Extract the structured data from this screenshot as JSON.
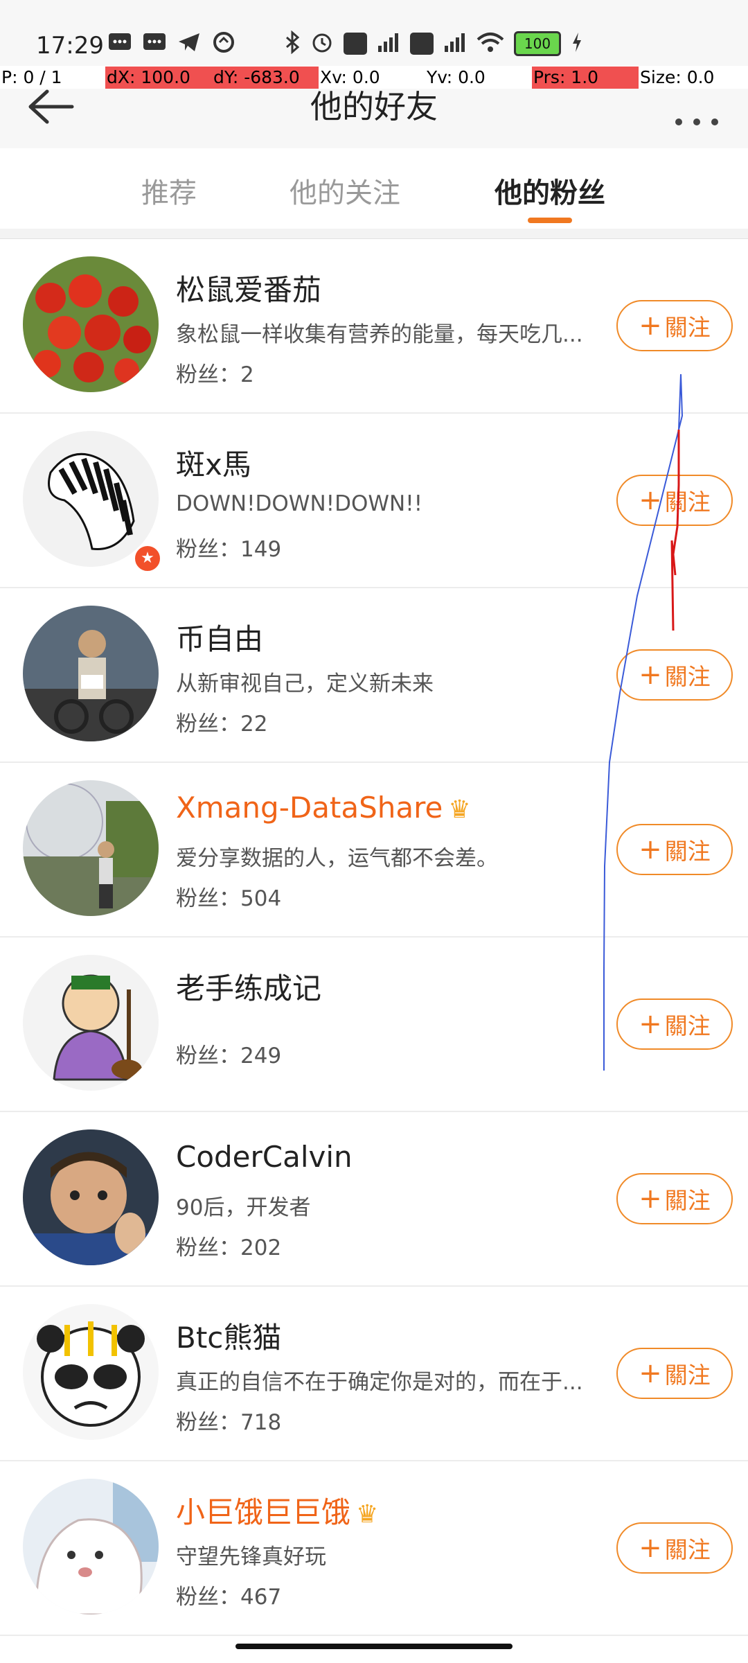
{
  "status_bar": {
    "time": "17:29",
    "battery": "100"
  },
  "debug": {
    "p": "P: 0 / 1",
    "dx": "dX: 100.0",
    "dy": "dY: -683.0",
    "xv": "Xv: 0.0",
    "yv": "Yv: 0.0",
    "prs": "Prs: 1.0",
    "size": "Size: 0.0"
  },
  "header": {
    "title": "他的好友",
    "back_icon": "arrow-left-icon",
    "more_icon": "more-dots-icon"
  },
  "tabs": [
    {
      "label": "推荐",
      "active": false
    },
    {
      "label": "他的关注",
      "active": false
    },
    {
      "label": "他的粉丝",
      "active": true
    }
  ],
  "follow_label": "關注",
  "users": [
    {
      "name": "松鼠爱番茄",
      "bio": "象松鼠一样收集有营养的能量，每天吃几...",
      "fans": "粉丝：2",
      "vip": false
    },
    {
      "name": "斑x馬",
      "bio": "DOWN!DOWN!DOWN!!",
      "fans": "粉丝：149",
      "vip": false,
      "verified_badge": true
    },
    {
      "name": "币自由",
      "bio": "从新审视自己，定义新未来",
      "fans": "粉丝：22",
      "vip": false
    },
    {
      "name": "Xmang-DataShare",
      "bio": "爱分享数据的人，运气都不会差。",
      "fans": "粉丝：504",
      "vip": true
    },
    {
      "name": "老手练成记",
      "bio": "",
      "fans": "粉丝：249",
      "vip": false
    },
    {
      "name": "CoderCalvin",
      "bio": "90后，开发者",
      "fans": "粉丝：202",
      "vip": false
    },
    {
      "name": "Btc熊猫",
      "bio": "真正的自信不在于确定你是对的，而在于...",
      "fans": "粉丝：718",
      "vip": false
    },
    {
      "name": "小巨饿巨巨饿",
      "bio": "守望先锋真好玩",
      "fans": "粉丝：467",
      "vip": true
    }
  ],
  "colors": {
    "accent": "#f07820",
    "vip_name": "#f06418"
  }
}
